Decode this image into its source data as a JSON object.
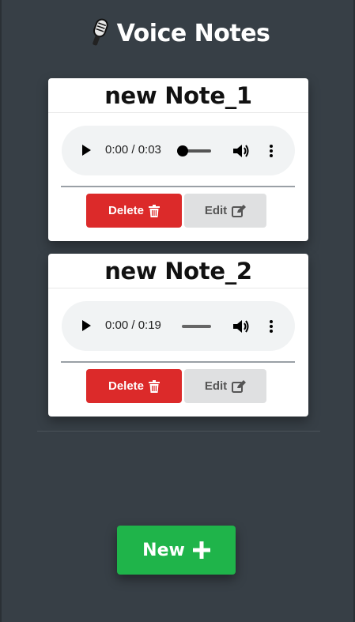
{
  "app": {
    "title": "Voice Notes",
    "icon": "microphone-icon"
  },
  "notes": [
    {
      "title": "new Note_1",
      "audio": {
        "time": "0:00 / 0:03",
        "progress": 0.0
      },
      "delete_label": "Delete",
      "edit_label": "Edit"
    },
    {
      "title": "new Note_2",
      "audio": {
        "time": "0:00 / 0:19",
        "progress": 0.0
      },
      "delete_label": "Delete",
      "edit_label": "Edit"
    }
  ],
  "new_button": {
    "label": "New",
    "icon": "plus-icon"
  },
  "colors": {
    "background": "#373f46",
    "delete": "#dc2a2a",
    "edit": "#dfe0e1",
    "new": "#1fb44a"
  }
}
